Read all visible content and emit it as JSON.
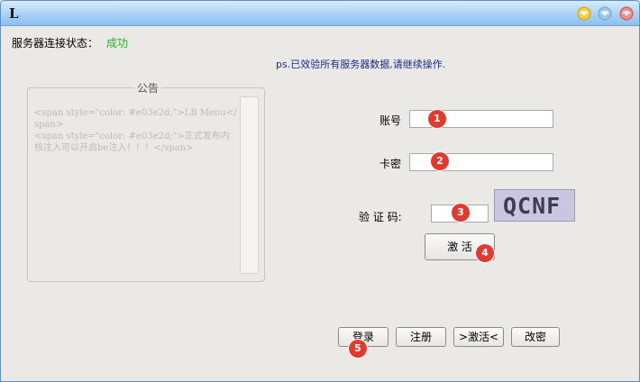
{
  "window": {
    "logo": "L"
  },
  "status": {
    "label": "服务器连接状态：",
    "value": "成功",
    "value_color": "#21b521"
  },
  "notice": "ps.已效验所有服务器数据,请继续操作.",
  "announcement": {
    "title": "公告",
    "content": "<span style=\"color: #e03e2d;\">LB Menu</span>\n<span style=\"color: #e03e2d;\">正式发布内核注入可以开启be注入！！！</span>"
  },
  "form": {
    "account_label": "账号",
    "account_value": "",
    "card_label": "卡密",
    "card_value": "",
    "captcha_label": "验 证 码:",
    "captcha_value": "",
    "captcha_image_text": "QCNF",
    "activate_label": "激 活"
  },
  "badges": [
    "1",
    "2",
    "3",
    "4",
    "5"
  ],
  "buttons": {
    "login": "登录",
    "register": "注册",
    "activate": ">激活<",
    "change_password": "改密"
  },
  "icons": {
    "titlebar": [
      "minimize-icon",
      "maximize-icon",
      "close-icon"
    ]
  }
}
